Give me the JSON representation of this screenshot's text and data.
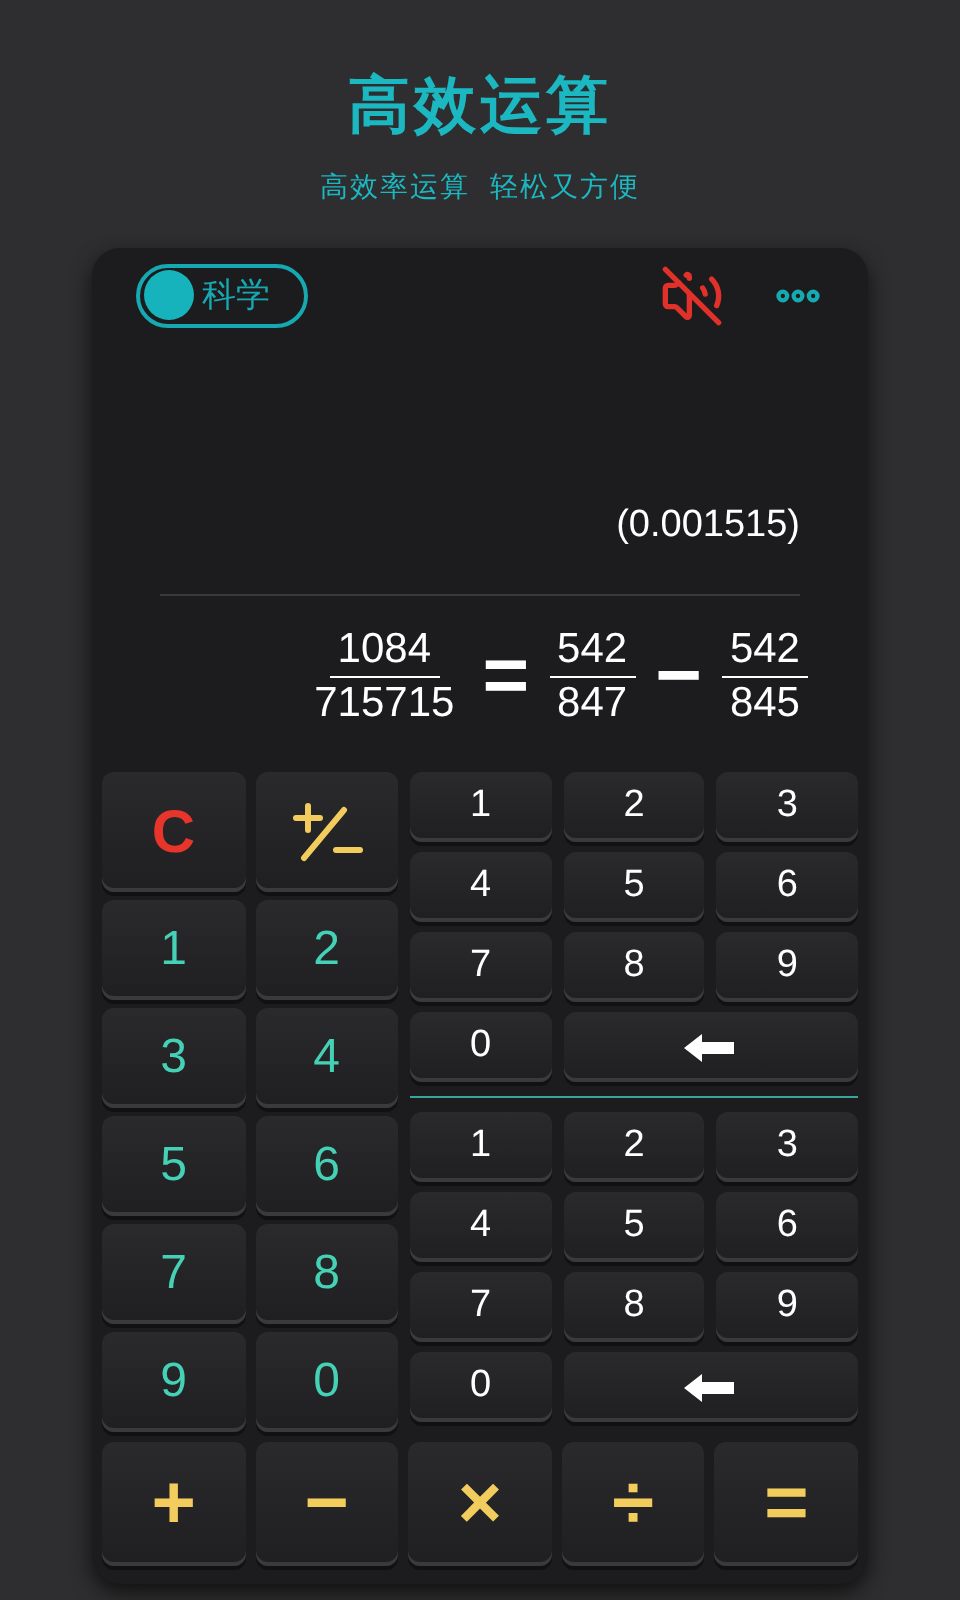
{
  "header": {
    "title": "高效运算",
    "subtitle": "高效率运算  轻松又方便"
  },
  "toolbar": {
    "mode_switch": {
      "label": "科学",
      "on": true
    },
    "sound_muted": true
  },
  "display": {
    "decimal": "(0.001515)",
    "expression": [
      {
        "kind": "fraction",
        "numerator": "1084",
        "denominator": "715715"
      },
      {
        "kind": "operator",
        "symbol": "="
      },
      {
        "kind": "fraction",
        "numerator": "542",
        "denominator": "847"
      },
      {
        "kind": "operator",
        "symbol": "−"
      },
      {
        "kind": "fraction",
        "numerator": "542",
        "denominator": "845"
      }
    ]
  },
  "left_keys": [
    {
      "kind": "clear",
      "label": "C"
    },
    {
      "kind": "sign"
    },
    {
      "kind": "digit",
      "label": "1"
    },
    {
      "kind": "digit",
      "label": "2"
    },
    {
      "kind": "digit",
      "label": "3"
    },
    {
      "kind": "digit",
      "label": "4"
    },
    {
      "kind": "digit",
      "label": "5"
    },
    {
      "kind": "digit",
      "label": "6"
    },
    {
      "kind": "digit",
      "label": "7"
    },
    {
      "kind": "digit",
      "label": "8"
    },
    {
      "kind": "digit",
      "label": "9"
    },
    {
      "kind": "digit",
      "label": "0"
    }
  ],
  "pads": [
    {
      "keys": [
        "1",
        "2",
        "3",
        "4",
        "5",
        "6",
        "7",
        "8",
        "9",
        "0"
      ]
    },
    {
      "keys": [
        "1",
        "2",
        "3",
        "4",
        "5",
        "6",
        "7",
        "8",
        "9",
        "0"
      ]
    }
  ],
  "operators": [
    "+",
    "−",
    "×",
    "÷",
    "="
  ]
}
